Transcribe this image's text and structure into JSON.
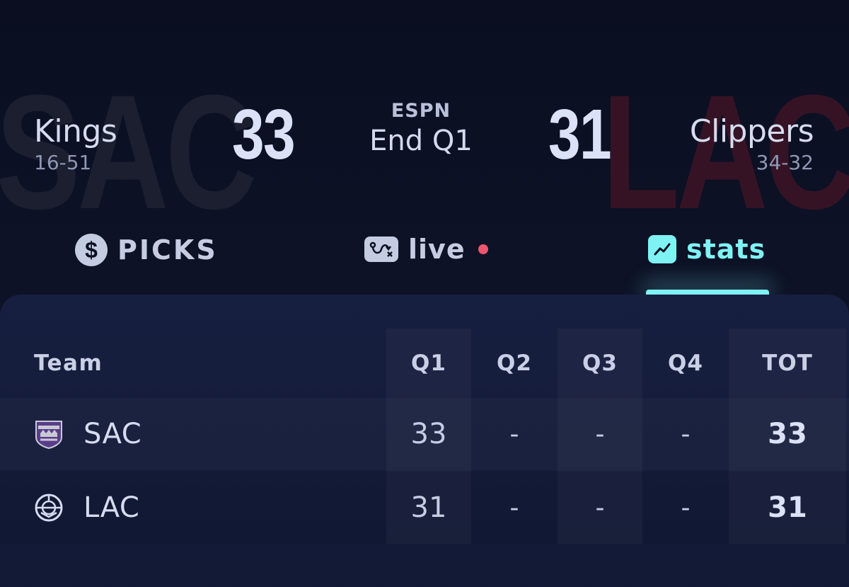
{
  "game": {
    "home": {
      "name": "Kings",
      "record": "16-51",
      "abbr": "SAC",
      "score": "33",
      "logo_icon": "kings-logo-icon"
    },
    "away": {
      "name": "Clippers",
      "record": "34-32",
      "abbr": "LAC",
      "score": "31",
      "logo_icon": "clippers-logo-icon"
    },
    "network": "ESPN",
    "status": "End Q1"
  },
  "tabs": [
    {
      "label": "PICKS",
      "icon": "dollar-icon",
      "active": false
    },
    {
      "label": "live",
      "icon": "play-diagram-icon",
      "active": false,
      "live_indicator": true
    },
    {
      "label": "stats",
      "icon": "trend-chart-icon",
      "active": true
    }
  ],
  "stats_table": {
    "headers": {
      "team": "Team",
      "q1": "Q1",
      "q2": "Q2",
      "q3": "Q3",
      "q4": "Q4",
      "tot": "TOT"
    },
    "rows": [
      {
        "team": "SAC",
        "q1": "33",
        "q2": "-",
        "q3": "-",
        "q4": "-",
        "tot": "33"
      },
      {
        "team": "LAC",
        "q1": "31",
        "q2": "-",
        "q3": "-",
        "q4": "-",
        "tot": "31"
      }
    ]
  },
  "colors": {
    "accent": "#7ff3f4",
    "live_dot": "#f0556e",
    "background": "#0b0f22",
    "card": "#171f40"
  }
}
